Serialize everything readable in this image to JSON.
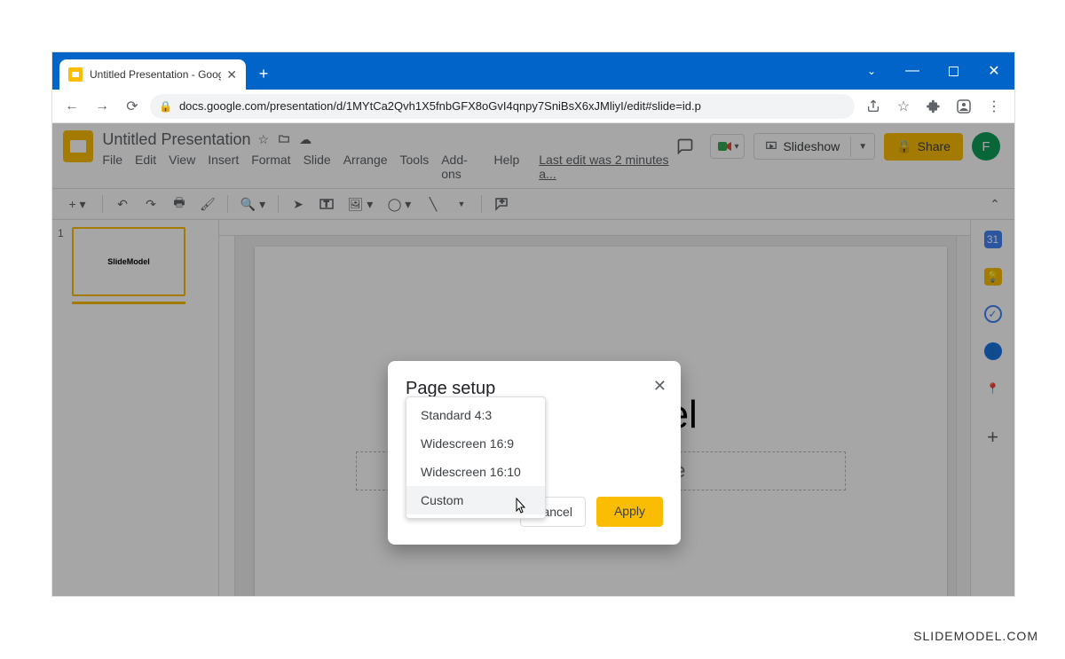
{
  "browser": {
    "tab_title": "Untitled Presentation - Google Sl",
    "url": "docs.google.com/presentation/d/1MYtCa2Qvh1X5fnbGFX8oGvI4qnpy7SniBsX6xJMliyI/edit#slide=id.p"
  },
  "doc": {
    "title": "Untitled Presentation",
    "last_edit": "Last edit was 2 minutes a...",
    "menus": [
      "File",
      "Edit",
      "View",
      "Insert",
      "Format",
      "Slide",
      "Arrange",
      "Tools",
      "Add-ons",
      "Help"
    ],
    "slideshow": "Slideshow",
    "share": "Share",
    "avatar_letter": "F"
  },
  "thumb": {
    "num": "1",
    "text": "SlideModel"
  },
  "slide": {
    "title": "SlideModel",
    "subtitle": "Click to add subtitle"
  },
  "dialog": {
    "title": "Page setup",
    "options": [
      "Standard 4:3",
      "Widescreen 16:9",
      "Widescreen 16:10",
      "Custom"
    ],
    "cancel": "Cancel",
    "apply": "Apply"
  },
  "watermark": "SLIDEMODEL.COM"
}
